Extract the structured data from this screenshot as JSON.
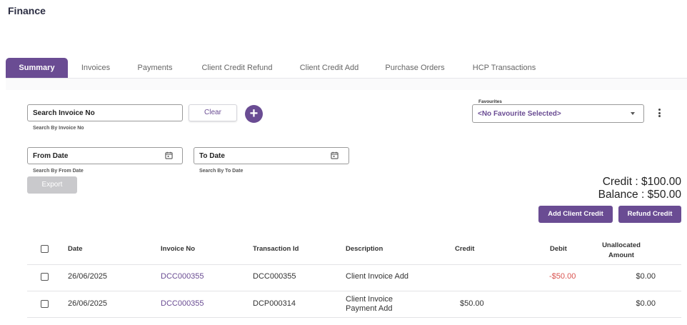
{
  "page": {
    "title": "Finance"
  },
  "tabs": [
    {
      "label": "Summary",
      "active": true
    },
    {
      "label": "Invoices"
    },
    {
      "label": "Payments"
    },
    {
      "label": "Client Credit Refund"
    },
    {
      "label": "Client Credit Add"
    },
    {
      "label": "Purchase Orders"
    },
    {
      "label": "HCP Transactions"
    }
  ],
  "filters": {
    "invoice": {
      "value": "Search Invoice No",
      "hint": "Search By Invoice No"
    },
    "clear_label": "Clear",
    "add_icon": "plus-circle-icon",
    "from_date": {
      "value": "From Date",
      "hint": "Search By From Date"
    },
    "to_date": {
      "value": "To Date",
      "hint": "Search By To Date"
    },
    "calendar_icon": "calendar-icon"
  },
  "favourites": {
    "label": "Favourites",
    "selected": "<No Favourite Selected>"
  },
  "export_label": "Export",
  "totals": {
    "credit": "Credit : $100.00",
    "balance": "Balance : $50.00"
  },
  "actions": {
    "add_client_credit": "Add Client Credit",
    "refund_credit": "Refund Credit"
  },
  "table": {
    "headers": {
      "date": "Date",
      "invoice_no": "Invoice No",
      "transaction_id": "Transaction Id",
      "description": "Description",
      "credit": "Credit",
      "debit": "Debit",
      "unallocated_1": "Unallocated",
      "unallocated_2": "Amount"
    },
    "rows": [
      {
        "date": "26/06/2025",
        "invoice_no": "DCC000355",
        "transaction_id": "DCC000355",
        "description_1": "Client Invoice Add",
        "description_2": "",
        "credit": "",
        "debit": "-$50.00",
        "unallocated": "$0.00"
      },
      {
        "date": "26/06/2025",
        "invoice_no": "DCC000355",
        "transaction_id": "DCP000314",
        "description_1": "Client Invoice",
        "description_2": "Payment Add",
        "credit": "$50.00",
        "debit": "",
        "unallocated": "$0.00"
      }
    ]
  },
  "colors": {
    "accent": "#6a4c93",
    "negative": "#d9534f",
    "disabled": "#c9c9cc"
  }
}
